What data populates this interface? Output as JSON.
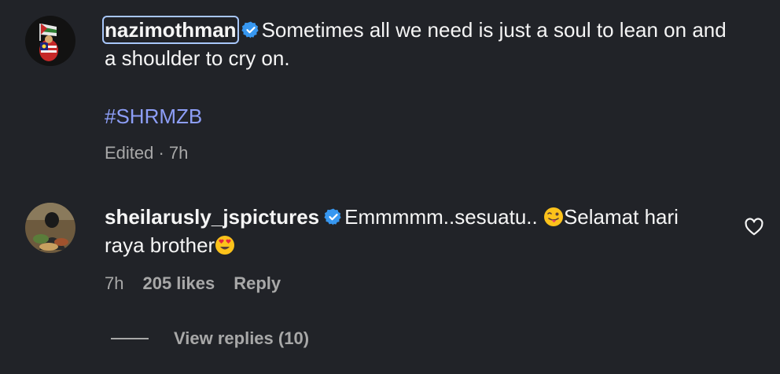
{
  "caption": {
    "username": "nazimothman",
    "text": "Sometimes all we need is just a soul to lean on and a shoulder to cry on.",
    "hashtag": "#SHRMZB",
    "meta": "Edited · 7h"
  },
  "comment": {
    "username": "sheilarusly_jspictures",
    "text_part1": "Emmmmm..sesuatu.. ",
    "text_part2": "Selamat hari raya brother",
    "time": "7h",
    "likes": "205 likes",
    "reply_label": "Reply"
  },
  "view_replies_label": "View replies (10)",
  "colors": {
    "background": "#212328",
    "text": "#f5f5f5",
    "secondary": "#a8a8a8",
    "hashtag": "#8d9ef7",
    "verified": "#3797f0"
  }
}
